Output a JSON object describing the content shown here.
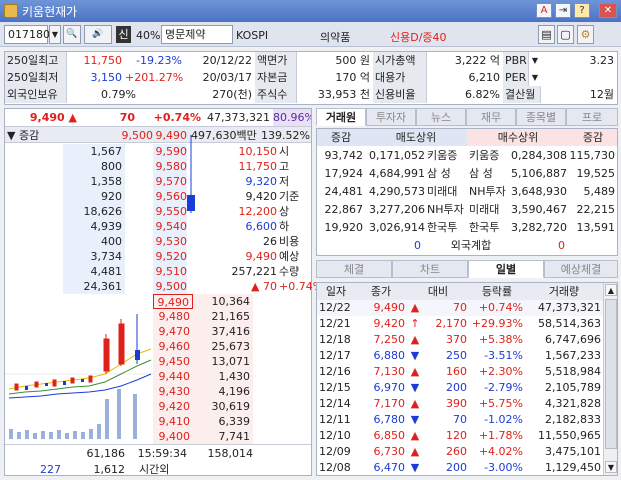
{
  "window": {
    "title": "키움현재가",
    "btn_a": "A",
    "btn_pin": "⇥",
    "btn_help": "?",
    "btn_close": "✕"
  },
  "toolbar": {
    "code": "017180",
    "search": "🔍",
    "speaker": "🔊",
    "buy_badge": "신",
    "margin": "40%",
    "name": "명문제약",
    "market": "KOSPI",
    "sector": "의약품",
    "credit": "신용D/증40",
    "icons": [
      "▤",
      "▢",
      "⚙"
    ]
  },
  "info": {
    "r1": {
      "l1": "250일최고",
      "v1": "11,750",
      "p1": "-19.23%",
      "d1": "20/12/22",
      "l2": "액면가",
      "v2": "500 원",
      "l3": "시가총액",
      "v3": "3,222 억",
      "l4": "PBR",
      "v4": "3.23"
    },
    "r2": {
      "l1": "250일최저",
      "v1": "3,150",
      "p1": "+201.27%",
      "d1": "20/03/17",
      "l2": "자본금",
      "v2": "170 억",
      "l3": "대용가",
      "v3": "6,210",
      "l4": "PER",
      "v4": ""
    },
    "r3": {
      "l1": "외국인보유",
      "v1": "0.79%",
      "d1": "270(천)",
      "l2": "주식수",
      "v2": "33,953 천",
      "l3": "신용비율",
      "v3": "6.82%",
      "l4": "결산월",
      "v4": "12월"
    }
  },
  "price": {
    "cur": "9,490",
    "arrow": "▲",
    "chg": "70",
    "pct": "+0.74%",
    "vol": "47,373,321",
    "vol_ratio": "80.96%"
  },
  "ob_header": {
    "c1": "증감",
    "c2": "9,500",
    "c3": "9,490",
    "c4": "497,630백만",
    "c5": "139.52%"
  },
  "asks": [
    {
      "inc": "",
      "qty": "1,567",
      "price": "9,590"
    },
    {
      "inc": "",
      "qty": "800",
      "price": "9,580"
    },
    {
      "inc": "",
      "qty": "1,358",
      "price": "9,570"
    },
    {
      "inc": "",
      "qty": "920",
      "price": "9,560"
    },
    {
      "inc": "",
      "qty": "18,626",
      "price": "9,550"
    },
    {
      "inc": "",
      "qty": "4,939",
      "price": "9,540"
    },
    {
      "inc": "",
      "qty": "400",
      "price": "9,530"
    },
    {
      "inc": "",
      "qty": "3,734",
      "price": "9,520"
    },
    {
      "inc": "",
      "qty": "4,481",
      "price": "9,510"
    },
    {
      "inc": "",
      "qty": "24,361",
      "price": "9,500"
    }
  ],
  "side_info": [
    {
      "v": "10,150",
      "k": "시",
      "cls": "up"
    },
    {
      "v": "11,750",
      "k": "고",
      "cls": "up"
    },
    {
      "v": "9,320",
      "k": "저",
      "cls": "dn"
    },
    {
      "v": "9,420",
      "k": "기준",
      "cls": ""
    },
    {
      "v": "12,200",
      "k": "상",
      "cls": "up"
    },
    {
      "v": "6,600",
      "k": "하",
      "cls": "dn"
    },
    {
      "v": "26",
      "k": "비용",
      "cls": ""
    },
    {
      "v": "9,490",
      "k": "예상",
      "cls": "up"
    },
    {
      "v": "257,221",
      "k": "수량",
      "cls": ""
    },
    {
      "v": "70",
      "k": "+0.74%",
      "cls": "up",
      "arrow": "▲"
    }
  ],
  "bids": [
    {
      "price": "9,490",
      "qty": "10,364"
    },
    {
      "price": "9,480",
      "qty": "21,165"
    },
    {
      "price": "9,470",
      "qty": "37,416"
    },
    {
      "price": "9,460",
      "qty": "25,673"
    },
    {
      "price": "9,450",
      "qty": "13,071"
    },
    {
      "price": "9,440",
      "qty": "1,430"
    },
    {
      "price": "9,430",
      "qty": "4,196"
    },
    {
      "price": "9,420",
      "qty": "30,619"
    },
    {
      "price": "9,410",
      "qty": "6,339"
    },
    {
      "price": "9,400",
      "qty": "7,741"
    }
  ],
  "ob_total": {
    "ask_total": "61,186",
    "time": "15:59:34",
    "bid_total": "158,014"
  },
  "ob_after": {
    "a": "227",
    "b": "1,612",
    "label": "시간외"
  },
  "right_tabs": [
    "거래원",
    "투자자",
    "뉴스",
    "재무",
    "종목별",
    "프로"
  ],
  "broker": {
    "headers": [
      "증감",
      "매도상위",
      "매수상위",
      "증감"
    ],
    "rows": [
      {
        "si": "93,742",
        "sq": "0,171,052",
        "sn": "키움증",
        "bn": "키움증",
        "bq": "0,284,308",
        "bi": "115,730"
      },
      {
        "si": "17,924",
        "sq": "4,684,991",
        "sn": "삼 성",
        "bn": "삼 성",
        "bq": "5,106,887",
        "bi": "19,525"
      },
      {
        "si": "24,481",
        "sq": "4,290,573",
        "sn": "미래대",
        "bn": "NH투자",
        "bq": "3,648,930",
        "bi": "5,489"
      },
      {
        "si": "22,867",
        "sq": "3,277,206",
        "sn": "NH투자",
        "bn": "미래대",
        "bq": "3,590,467",
        "bi": "22,215"
      },
      {
        "si": "19,920",
        "sq": "3,026,914",
        "sn": "한국투",
        "bn": "한국투",
        "bq": "3,282,720",
        "bi": "13,591"
      }
    ],
    "foreign": {
      "s": "0",
      "label": "외국계합",
      "b": "0"
    }
  },
  "bottom_tabs": [
    "체결",
    "차트",
    "일별",
    "예상체결"
  ],
  "daily": {
    "headers": [
      "일자",
      "종가",
      "대비",
      "등락률",
      "거래량"
    ],
    "rows": [
      {
        "d": "12/22",
        "p": "9,490",
        "a": "▲",
        "c": "70",
        "r": "+0.74%",
        "v": "47,373,321",
        "dir": "up"
      },
      {
        "d": "12/21",
        "p": "9,420",
        "a": "↑",
        "c": "2,170",
        "r": "+29.93%",
        "v": "58,514,363",
        "dir": "up"
      },
      {
        "d": "12/18",
        "p": "7,250",
        "a": "▲",
        "c": "370",
        "r": "+5.38%",
        "v": "6,747,696",
        "dir": "up"
      },
      {
        "d": "12/17",
        "p": "6,880",
        "a": "▼",
        "c": "250",
        "r": "-3.51%",
        "v": "1,567,233",
        "dir": "dn"
      },
      {
        "d": "12/16",
        "p": "7,130",
        "a": "▲",
        "c": "160",
        "r": "+2.30%",
        "v": "5,518,984",
        "dir": "up"
      },
      {
        "d": "12/15",
        "p": "6,970",
        "a": "▼",
        "c": "200",
        "r": "-2.79%",
        "v": "2,105,789",
        "dir": "dn"
      },
      {
        "d": "12/14",
        "p": "7,170",
        "a": "▲",
        "c": "390",
        "r": "+5.75%",
        "v": "4,321,828",
        "dir": "up"
      },
      {
        "d": "12/11",
        "p": "6,780",
        "a": "▼",
        "c": "70",
        "r": "-1.02%",
        "v": "2,182,833",
        "dir": "dn"
      },
      {
        "d": "12/10",
        "p": "6,850",
        "a": "▲",
        "c": "120",
        "r": "+1.78%",
        "v": "11,550,965",
        "dir": "up"
      },
      {
        "d": "12/09",
        "p": "6,730",
        "a": "▲",
        "c": "260",
        "r": "+4.02%",
        "v": "3,475,101",
        "dir": "up"
      },
      {
        "d": "12/08",
        "p": "6,470",
        "a": "▼",
        "c": "200",
        "r": "-3.00%",
        "v": "1,129,450",
        "dir": "dn"
      }
    ]
  },
  "colors": {
    "up": "#e0211b",
    "down": "#1b3cd6",
    "ask_bg": "#e8f0fb",
    "bid_bg": "#fdeeee",
    "selected_tab": "#ffffff"
  }
}
